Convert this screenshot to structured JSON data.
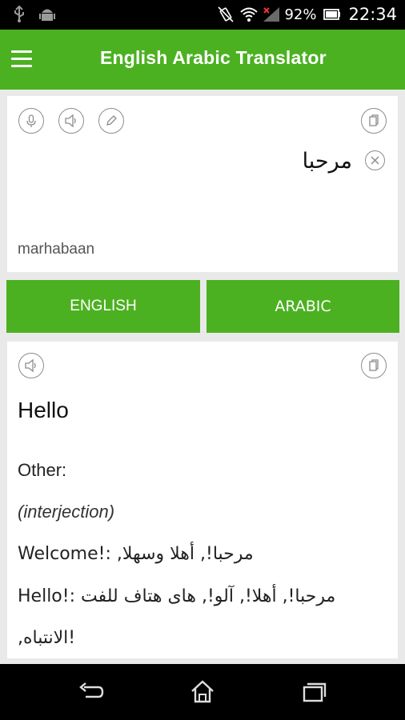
{
  "status_bar": {
    "battery": "92%",
    "time": "22:34"
  },
  "app_bar": {
    "title": "English Arabic Translator"
  },
  "input_card": {
    "text": "مرحبا",
    "transliteration": "marhabaan"
  },
  "languages": {
    "source": "ENGLISH",
    "target": "ARABIC"
  },
  "output_card": {
    "translation": "Hello",
    "other_label": "Other:",
    "part_of_speech": "(interjection)",
    "lines": [
      "Welcome!: ,مرحبا!, أهلا وسهلا",
      "Hello!: مرحبا!, أهلا!, آلو!, هاى هتاف للفت",
      ",الانتباه!"
    ]
  },
  "colors": {
    "accent": "#4cb121",
    "background": "#e9e9e9"
  }
}
